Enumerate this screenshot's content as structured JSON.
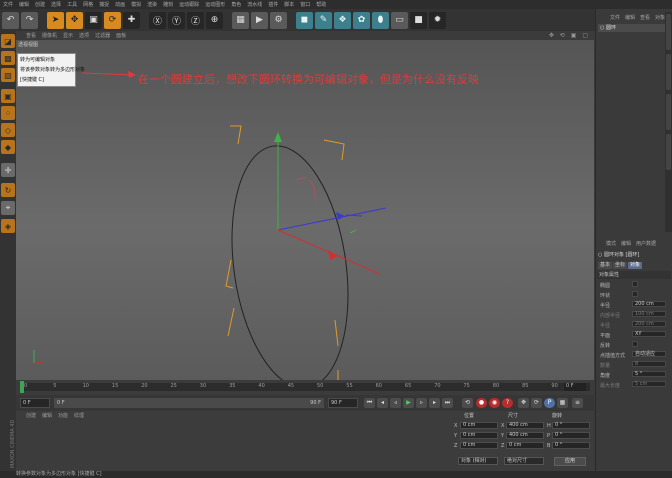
{
  "menubar": [
    "文件",
    "编辑",
    "创建",
    "选择",
    "工具",
    "网格",
    "捕捉",
    "动画",
    "模拟",
    "渲染",
    "雕刻",
    "运动跟踪",
    "运动图形",
    "角色",
    "流水线",
    "插件",
    "脚本",
    "窗口",
    "帮助"
  ],
  "viewport_menu": [
    "查看",
    "摄像机",
    "显示",
    "选项",
    "过滤器",
    "面板"
  ],
  "viewport_title": "透视视图",
  "context_menu": [
    "转为可编辑对象",
    "将该参数对象转为多边形对象",
    "[快捷键 C]"
  ],
  "annotation": "在一个圆建立后，想改下圆环转换为可编辑对象，但是为什么没有反映",
  "timeline": {
    "ticks": [
      "0",
      "5",
      "10",
      "15",
      "20",
      "25",
      "30",
      "35",
      "40",
      "45",
      "50",
      "55",
      "60",
      "65",
      "70",
      "75",
      "80",
      "85",
      "90"
    ],
    "current_frame": "0 F"
  },
  "transport": {
    "start": "0 F",
    "min": "0 F",
    "max": "90 F",
    "end": "90 F"
  },
  "material_menu": [
    "创建",
    "编辑",
    "功能",
    "纹理"
  ],
  "coords": {
    "header_pos": "位置",
    "header_size": "尺寸",
    "header_rot": "旋转",
    "rows": [
      {
        "axis": "X",
        "pos": "0 cm",
        "size_axis": "X",
        "size": "400 cm",
        "rot_axis": "H",
        "rot": "0 °"
      },
      {
        "axis": "Y",
        "pos": "0 cm",
        "size_axis": "Y",
        "size": "400 cm",
        "rot_axis": "P",
        "rot": "0 °"
      },
      {
        "axis": "Z",
        "pos": "0 cm",
        "size_axis": "Z",
        "size": "0 cm",
        "rot_axis": "B",
        "rot": "0 °"
      }
    ],
    "mode1": "对象 (相对)",
    "mode2": "绝对尺寸",
    "apply": "应用"
  },
  "status_text": "转换参数对象为多边形对象 [快捷键 C]",
  "brand": "MAXON CINEMA 4D",
  "object_panel": {
    "menu": [
      "文件",
      "编辑",
      "查看",
      "对象"
    ],
    "item": "圆环"
  },
  "attr_panel": {
    "menu": [
      "模式",
      "编辑",
      "用户数据"
    ],
    "title": "圆环对象 [圆环]",
    "tabs": [
      "基本",
      "坐标",
      "对象"
    ],
    "section": "对象属性",
    "rows": [
      {
        "label": "椭圆",
        "value": "",
        "dim": false
      },
      {
        "label": "环状",
        "value": "",
        "dim": false
      },
      {
        "label": "半径",
        "value": "200 cm",
        "dim": false
      },
      {
        "label": "内部半径",
        "value": "100 cm",
        "dim": true
      },
      {
        "label": "半径",
        "value": "200 cm",
        "dim": true
      },
      {
        "label": "平面",
        "value": "XY",
        "dim": false
      },
      {
        "label": "反转",
        "value": "",
        "dim": false
      },
      {
        "label": "点插值方式",
        "value": "自动适应",
        "dim": false
      },
      {
        "label": "数量",
        "value": "8",
        "dim": true
      },
      {
        "label": "角度",
        "value": "5 °",
        "dim": false
      },
      {
        "label": "最大长度",
        "value": "5 cm",
        "dim": true
      }
    ]
  },
  "colors": {
    "accent_orange": "#d78a1f",
    "annotation_red": "#e23a3a",
    "axis_green": "#39b54a",
    "axis_blue": "#3a3ad0",
    "axis_red": "#d03030"
  }
}
